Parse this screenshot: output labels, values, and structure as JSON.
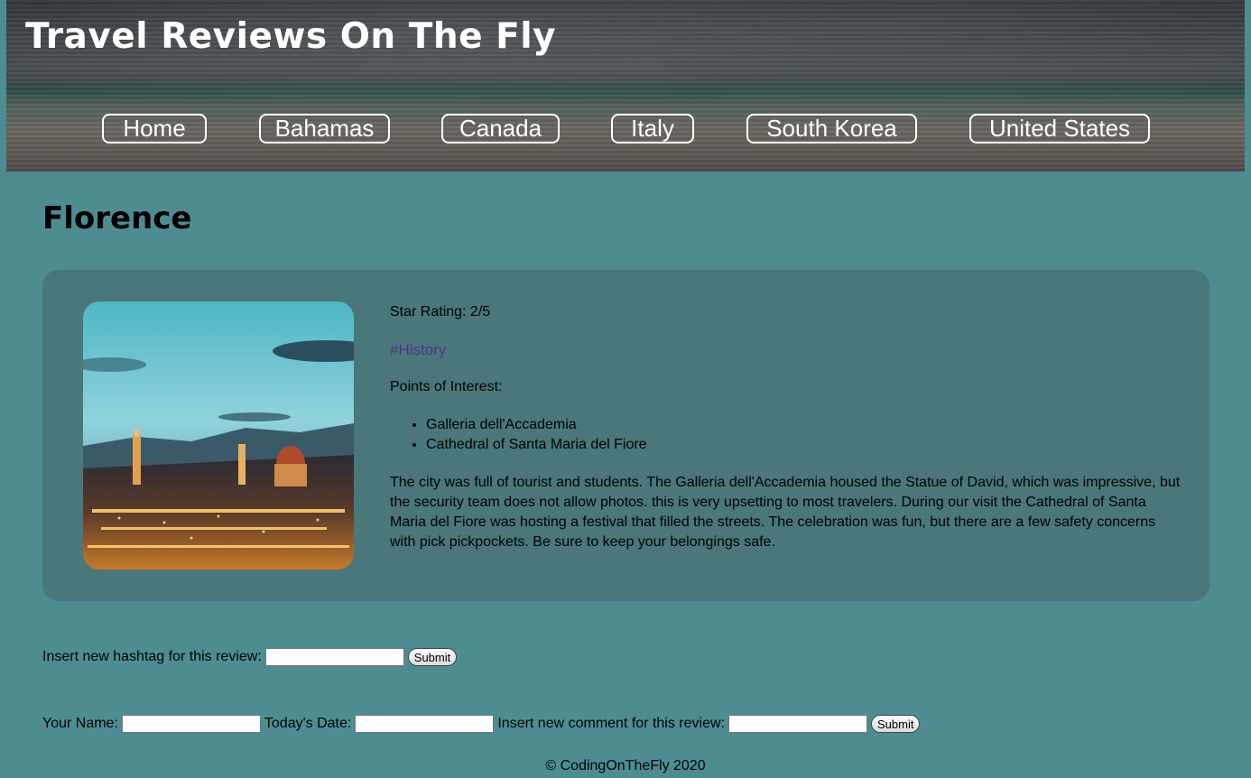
{
  "header": {
    "title": "Travel Reviews On The Fly",
    "nav": [
      {
        "label": "Home"
      },
      {
        "label": "Bahamas"
      },
      {
        "label": "Canada"
      },
      {
        "label": "Italy"
      },
      {
        "label": "South Korea"
      },
      {
        "label": "United States"
      }
    ]
  },
  "page": {
    "title": "Florence"
  },
  "review": {
    "rating": "Star Rating: 2/5",
    "hashtag": "#History",
    "poi_label": "Points of Interest:",
    "points_of_interest": [
      "Galleria dell'Accademia",
      "Cathedral of Santa Maria del Fiore"
    ],
    "description": "The city was full of tourist and students. The Galleria dell'Accademia housed the Statue of David, which was impressive, but the security team does not allow photos. this is very upsetting to most travelers. During our visit the Cathedral of Santa Maria del Fiore was hosting a festival that filled the streets. The celebration was fun, but there are a few safety concerns with pick pickpockets. Be sure to keep your belongings safe."
  },
  "hashtag_form": {
    "label": "Insert new hashtag for this review:",
    "value": "",
    "submit": "Submit"
  },
  "comment_form": {
    "name_label": "Your Name:",
    "name_value": "",
    "date_label": "Today's Date:",
    "date_value": "",
    "comment_label": "Insert new comment for this review:",
    "comment_value": "",
    "submit": "Submit"
  },
  "footer": {
    "text": "© CodingOnTheFly 2020"
  },
  "colors": {
    "page_bg": "#4d8d92",
    "card_bg": "#4a7779",
    "hashtag": "#5a2e8c"
  }
}
